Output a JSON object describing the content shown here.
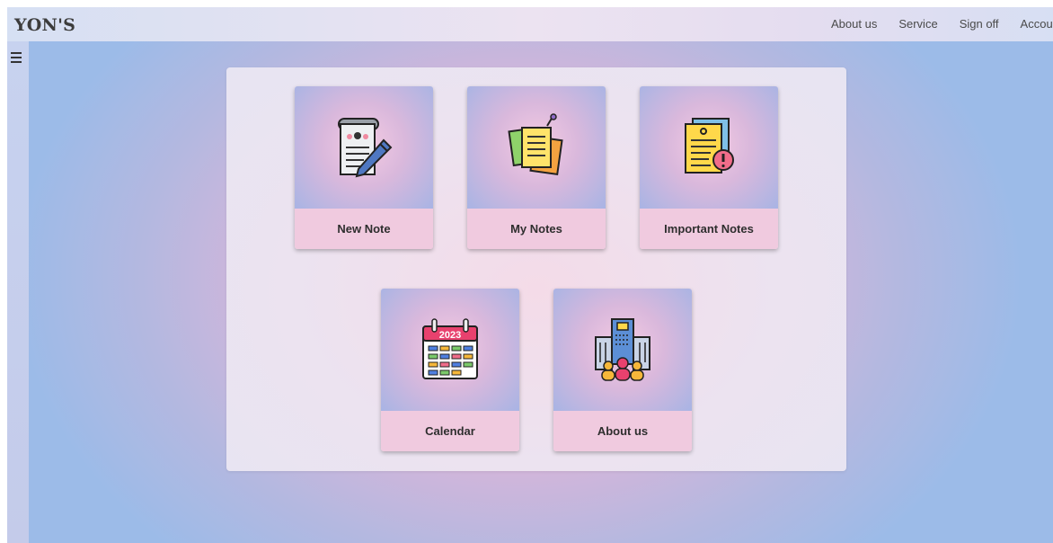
{
  "header": {
    "logo": "YON'S",
    "nav": [
      "About us",
      "Service",
      "Sign off",
      "Account"
    ]
  },
  "cards": [
    {
      "label": "New Note",
      "icon": "scroll-pencil-icon"
    },
    {
      "label": "My Notes",
      "icon": "sticky-notes-icon"
    },
    {
      "label": "Important Notes",
      "icon": "important-document-icon"
    },
    {
      "label": "Calendar",
      "icon": "calendar-icon",
      "year": "2023"
    },
    {
      "label": "About us",
      "icon": "building-people-icon"
    }
  ],
  "colors": {
    "card_label_bg": "#f0cadf",
    "calendar_header": "#e8416e"
  }
}
